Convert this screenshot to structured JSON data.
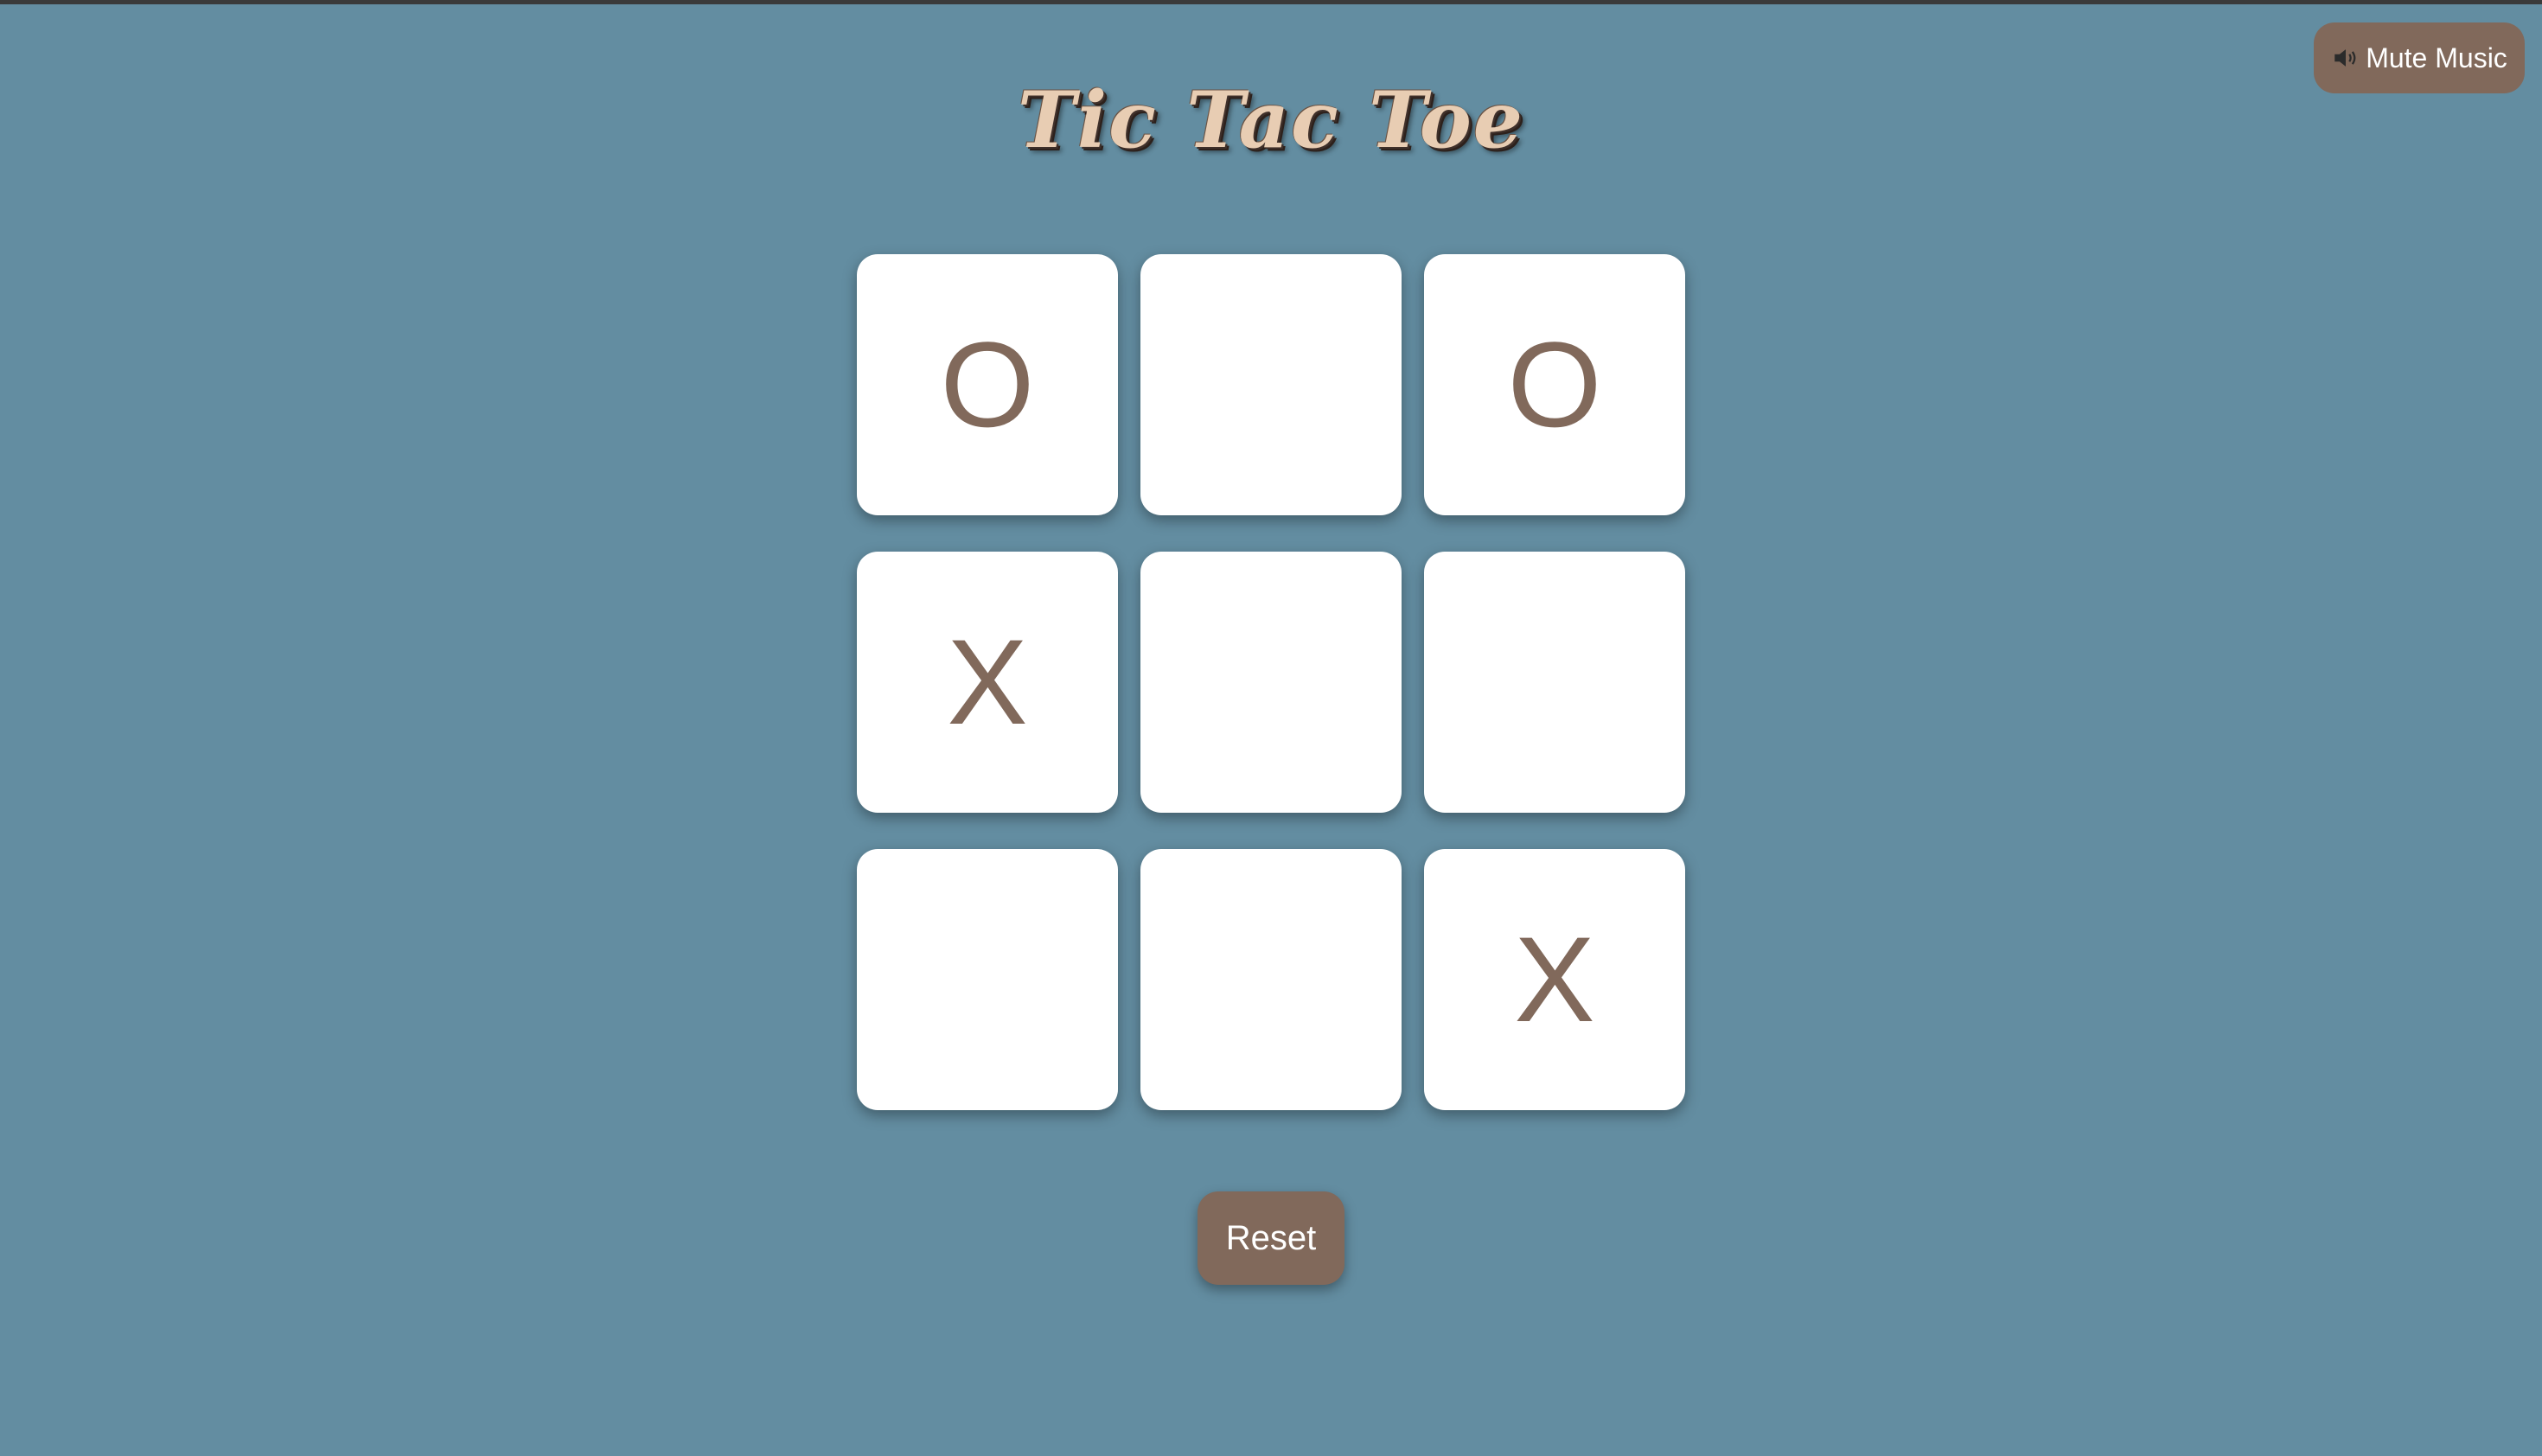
{
  "header": {
    "title": "Tic Tac Toe"
  },
  "controls": {
    "mute_label": "Mute Music",
    "mute_icon": "speaker-icon",
    "reset_label": "Reset"
  },
  "board": {
    "cells": [
      "O",
      "",
      "O",
      "X",
      "",
      "",
      "",
      "",
      "X"
    ]
  },
  "colors": {
    "background": "#638da1",
    "button": "#81695b",
    "mark": "#81695b",
    "cell": "#ffffff",
    "title": "#e8cdb3"
  }
}
